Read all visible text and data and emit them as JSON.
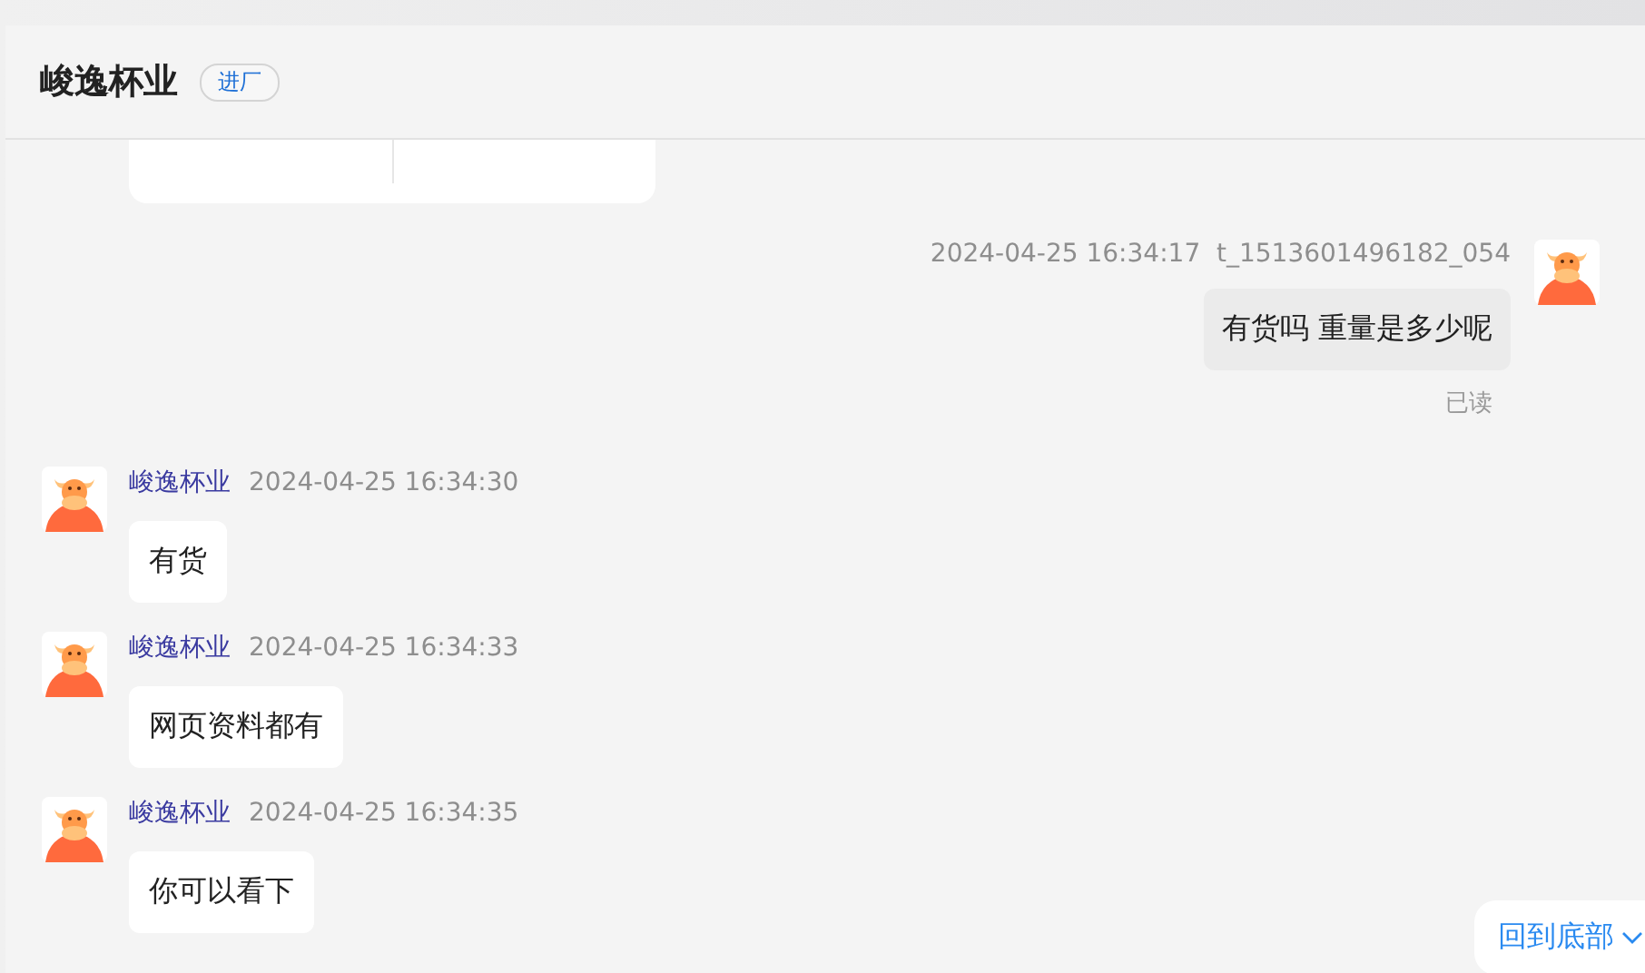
{
  "header": {
    "title": "峻逸杯业",
    "badge": "进厂"
  },
  "messages": [
    {
      "kind": "self",
      "time": "2024-04-25 16:34:17",
      "sender": "t_1513601496182_054",
      "text": "有货吗 重量是多少呢",
      "status": "已读"
    },
    {
      "kind": "other",
      "sender": "峻逸杯业",
      "time": "2024-04-25 16:34:30",
      "text": "有货"
    },
    {
      "kind": "other",
      "sender": "峻逸杯业",
      "time": "2024-04-25 16:34:33",
      "text": "网页资料都有"
    },
    {
      "kind": "other",
      "sender": "峻逸杯业",
      "time": "2024-04-25 16:34:35",
      "text": "你可以看下"
    }
  ],
  "scroll_button": {
    "label": "回到底部"
  }
}
